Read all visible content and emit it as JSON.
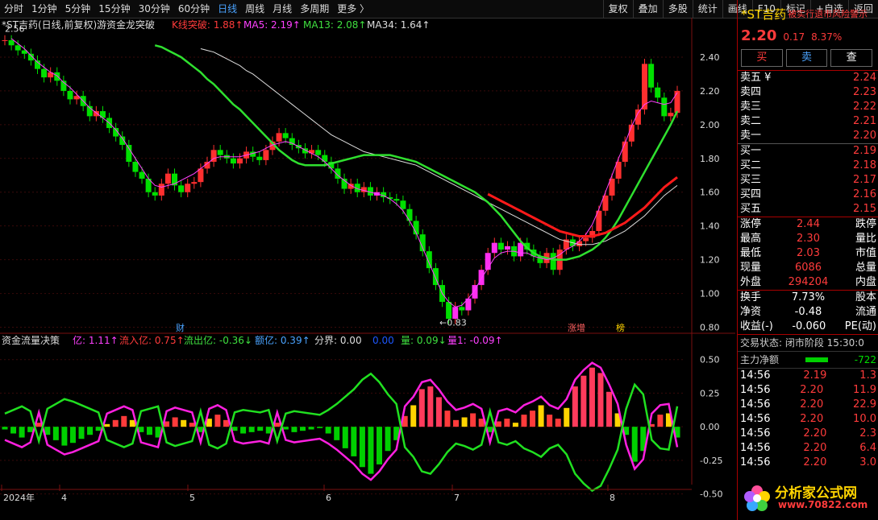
{
  "toolbar": {
    "tabs": [
      "分时",
      "1分钟",
      "5分钟",
      "15分钟",
      "30分钟",
      "60分钟",
      "日线",
      "周线",
      "月线",
      "多周期",
      "更多 〉"
    ],
    "active": "日线",
    "right_tabs": [
      "复权",
      "叠加",
      "多股",
      "统计",
      "画线",
      "F10",
      "标记",
      "+自选",
      "返回"
    ]
  },
  "main_header": {
    "stock_title": "*ST吉药(日线,前复权)",
    "indicator_name": "游资金龙突破",
    "k_break": "K线突破: 1.88↑",
    "ma5": "MA5: 2.19↑",
    "ma13": "MA13: 2.08↑",
    "ma34": "MA34: 1.64↑"
  },
  "sub_header": {
    "name": "资金流量决策",
    "yi": "亿: 1.11↑",
    "inflow": "流入亿: 0.75↑",
    "outflow": "流出亿: -0.36↓",
    "amount": "额亿: 0.39↑",
    "boundary": "分界: 0.00",
    "hidden": "0.00",
    "vol": "量: 0.09↓",
    "vol1": "量1: -0.09↑"
  },
  "chart_data": [
    {
      "type": "candlestick",
      "title": "*ST吉药(日线,前复权)",
      "ylim": [
        0.75,
        2.5
      ],
      "yticks": [
        "2.40",
        "2.20",
        "2.00",
        "1.80",
        "1.60",
        "1.40",
        "1.20",
        "1.00",
        "0.80"
      ],
      "xticks": [
        "2024年",
        "4",
        "5",
        "6",
        "7",
        "8"
      ],
      "annotations": [
        "2.56",
        "0.83",
        "财",
        "涨增",
        "榜"
      ],
      "closes": [
        2.5,
        2.47,
        2.44,
        2.42,
        2.38,
        2.33,
        2.28,
        2.31,
        2.26,
        2.2,
        2.15,
        2.17,
        2.11,
        2.05,
        2.08,
        2.04,
        1.98,
        1.93,
        1.88,
        1.78,
        1.72,
        1.68,
        1.6,
        1.58,
        1.65,
        1.71,
        1.64,
        1.6,
        1.65,
        1.66,
        1.74,
        1.78,
        1.85,
        1.82,
        1.8,
        1.77,
        1.8,
        1.84,
        1.81,
        1.79,
        1.85,
        1.9,
        1.95,
        1.92,
        1.88,
        1.86,
        1.83,
        1.85,
        1.82,
        1.78,
        1.74,
        1.68,
        1.62,
        1.65,
        1.6,
        1.63,
        1.58,
        1.6,
        1.57,
        1.56,
        1.55,
        1.5,
        1.43,
        1.35,
        1.25,
        1.15,
        1.05,
        0.95,
        0.85,
        0.92,
        0.9,
        0.97,
        1.05,
        1.14,
        1.24,
        1.3,
        1.26,
        1.28,
        1.22,
        1.3,
        1.26,
        1.22,
        1.18,
        1.24,
        1.14,
        1.26,
        1.32,
        1.28,
        1.31,
        1.33,
        1.37,
        1.49,
        1.58,
        1.68,
        1.78,
        1.9,
        2.0,
        2.09,
        2.36,
        2.22,
        2.16,
        2.05,
        2.07,
        2.2
      ],
      "ma5": [
        2.51,
        2.48,
        2.45,
        2.41,
        2.37,
        2.34,
        2.31,
        2.29,
        2.25,
        2.22,
        2.18,
        2.14,
        2.1,
        2.07,
        2.04,
        2.01,
        1.97,
        1.92,
        1.86,
        1.8,
        1.74,
        1.68,
        1.64,
        1.63,
        1.64,
        1.65,
        1.67,
        1.69,
        1.71,
        1.74,
        1.77,
        1.8,
        1.81,
        1.81,
        1.81,
        1.81,
        1.82,
        1.83,
        1.84,
        1.86,
        1.88,
        1.89,
        1.9,
        1.89,
        1.87,
        1.85,
        1.83,
        1.81,
        1.78,
        1.74,
        1.7,
        1.67,
        1.64,
        1.62,
        1.61,
        1.6,
        1.59,
        1.58,
        1.56,
        1.53,
        1.49,
        1.43,
        1.36,
        1.27,
        1.18,
        1.09,
        1.0,
        0.95,
        0.92,
        0.93,
        0.97,
        1.02,
        1.09,
        1.15,
        1.21,
        1.24,
        1.25,
        1.25,
        1.24,
        1.24,
        1.22,
        1.21,
        1.2,
        1.21,
        1.23,
        1.26,
        1.28,
        1.31,
        1.35,
        1.41,
        1.5,
        1.6,
        1.7,
        1.8,
        1.89,
        1.99,
        2.07,
        2.12,
        2.14,
        2.13,
        2.12,
        2.13,
        2.19
      ],
      "ma13": [
        2.47,
        2.46,
        2.44,
        2.42,
        2.4,
        2.37,
        2.34,
        2.31,
        2.27,
        2.24,
        2.2,
        2.16,
        2.12,
        2.09,
        2.05,
        2.01,
        1.97,
        1.93,
        1.89,
        1.85,
        1.82,
        1.79,
        1.77,
        1.76,
        1.76,
        1.76,
        1.76,
        1.77,
        1.78,
        1.79,
        1.8,
        1.81,
        1.82,
        1.82,
        1.82,
        1.82,
        1.82,
        1.81,
        1.8,
        1.79,
        1.78,
        1.76,
        1.74,
        1.72,
        1.7,
        1.68,
        1.66,
        1.64,
        1.62,
        1.6,
        1.57,
        1.54,
        1.5,
        1.46,
        1.41,
        1.36,
        1.31,
        1.27,
        1.24,
        1.22,
        1.21,
        1.2,
        1.2,
        1.2,
        1.21,
        1.22,
        1.24,
        1.26,
        1.29,
        1.33,
        1.38,
        1.44,
        1.51,
        1.58,
        1.65,
        1.72,
        1.79,
        1.86,
        1.93,
        2.0,
        2.08
      ],
      "ma34": [
        2.45,
        2.44,
        2.43,
        2.41,
        2.39,
        2.37,
        2.35,
        2.32,
        2.3,
        2.27,
        2.24,
        2.21,
        2.18,
        2.15,
        2.12,
        2.09,
        2.06,
        2.03,
        2.0,
        1.97,
        1.94,
        1.92,
        1.9,
        1.88,
        1.86,
        1.84,
        1.83,
        1.82,
        1.81,
        1.8,
        1.79,
        1.78,
        1.77,
        1.76,
        1.74,
        1.72,
        1.7,
        1.68,
        1.66,
        1.64,
        1.62,
        1.6,
        1.58,
        1.56,
        1.54,
        1.52,
        1.5,
        1.48,
        1.46,
        1.44,
        1.42,
        1.4,
        1.38,
        1.36,
        1.34,
        1.32,
        1.31,
        1.3,
        1.29,
        1.29,
        1.29,
        1.3,
        1.31,
        1.33,
        1.35,
        1.37,
        1.4,
        1.43,
        1.46,
        1.5,
        1.54,
        1.58,
        1.61,
        1.64
      ]
    },
    {
      "type": "bar",
      "title": "资金流量决策",
      "ylim": [
        -0.55,
        0.6
      ],
      "yticks": [
        "0.50",
        "0.25",
        "0.00",
        "-0.25",
        "-0.50"
      ],
      "values": [
        -0.02,
        -0.05,
        -0.08,
        -0.04,
        0.03,
        -0.06,
        -0.1,
        -0.14,
        -0.12,
        -0.09,
        -0.06,
        -0.03,
        0.02,
        0.05,
        0.08,
        0.05,
        -0.04,
        -0.06,
        -0.08,
        0.04,
        0.07,
        0.05,
        0.03,
        -0.04,
        0.06,
        0.09,
        0.05,
        -0.03,
        -0.05,
        -0.04,
        -0.03,
        -0.05,
        0.03,
        -0.02,
        -0.04,
        -0.03,
        -0.02,
        -0.01,
        -0.05,
        -0.1,
        -0.16,
        -0.22,
        -0.3,
        -0.35,
        -0.28,
        -0.18,
        -0.1,
        0.08,
        0.16,
        0.28,
        0.3,
        0.22,
        0.12,
        0.05,
        0.07,
        0.1,
        0.06,
        -0.04,
        0.04,
        0.06,
        0.03,
        0.09,
        0.12,
        0.16,
        0.09,
        0.06,
        0.14,
        0.3,
        0.38,
        0.44,
        0.4,
        0.26,
        0.1,
        -0.06,
        -0.26,
        -0.18,
        0.02,
        0.09,
        0.1,
        -0.08
      ]
    }
  ],
  "info": {
    "ticker": "*ST吉药",
    "notice": "被实行退市风险警示",
    "price": "2.20",
    "change": "0.17",
    "pct": "8.37%",
    "buy": "买",
    "sell": "卖",
    "query": "查",
    "asks": [
      [
        "卖五 ¥",
        "2.24"
      ],
      [
        "卖四",
        "2.23"
      ],
      [
        "卖三",
        "2.22"
      ],
      [
        "卖二",
        "2.21"
      ],
      [
        "卖一",
        "2.20"
      ]
    ],
    "bids": [
      [
        "买一",
        "2.19"
      ],
      [
        "买二",
        "2.18"
      ],
      [
        "买三",
        "2.17"
      ],
      [
        "买四",
        "2.16"
      ],
      [
        "买五",
        "2.15"
      ]
    ],
    "stats": [
      [
        "涨停",
        "2.44",
        "跌停"
      ],
      [
        "最高",
        "2.30",
        "量比"
      ],
      [
        "最低",
        "2.03",
        "市值"
      ],
      [
        "现量",
        "6086",
        "总量"
      ],
      [
        "外盘",
        "294204",
        "内盘"
      ]
    ],
    "stats2": [
      [
        "换手",
        "7.73%",
        "股本"
      ],
      [
        "净资",
        "-0.48",
        "流通"
      ],
      [
        "收益(-)",
        "-0.060",
        "PE(动)"
      ]
    ],
    "trade_status": "交易状态: 闭市阶段  15:30:0",
    "main_flow_label": "主力净额",
    "main_flow_value": "-722",
    "ticks": [
      [
        "14:56",
        "2.19",
        "1.3"
      ],
      [
        "14:56",
        "2.20",
        "11.9"
      ],
      [
        "14:56",
        "2.20",
        "22.9"
      ],
      [
        "14:56",
        "2.20",
        "10.0"
      ],
      [
        "14:56",
        "2.20",
        "2.3"
      ],
      [
        "14:56",
        "2.20",
        "6.4"
      ],
      [
        "14:56",
        "2.20",
        "3.0"
      ]
    ],
    "logo_text": "分析家公式网",
    "logo_url": "www.70822.com"
  }
}
